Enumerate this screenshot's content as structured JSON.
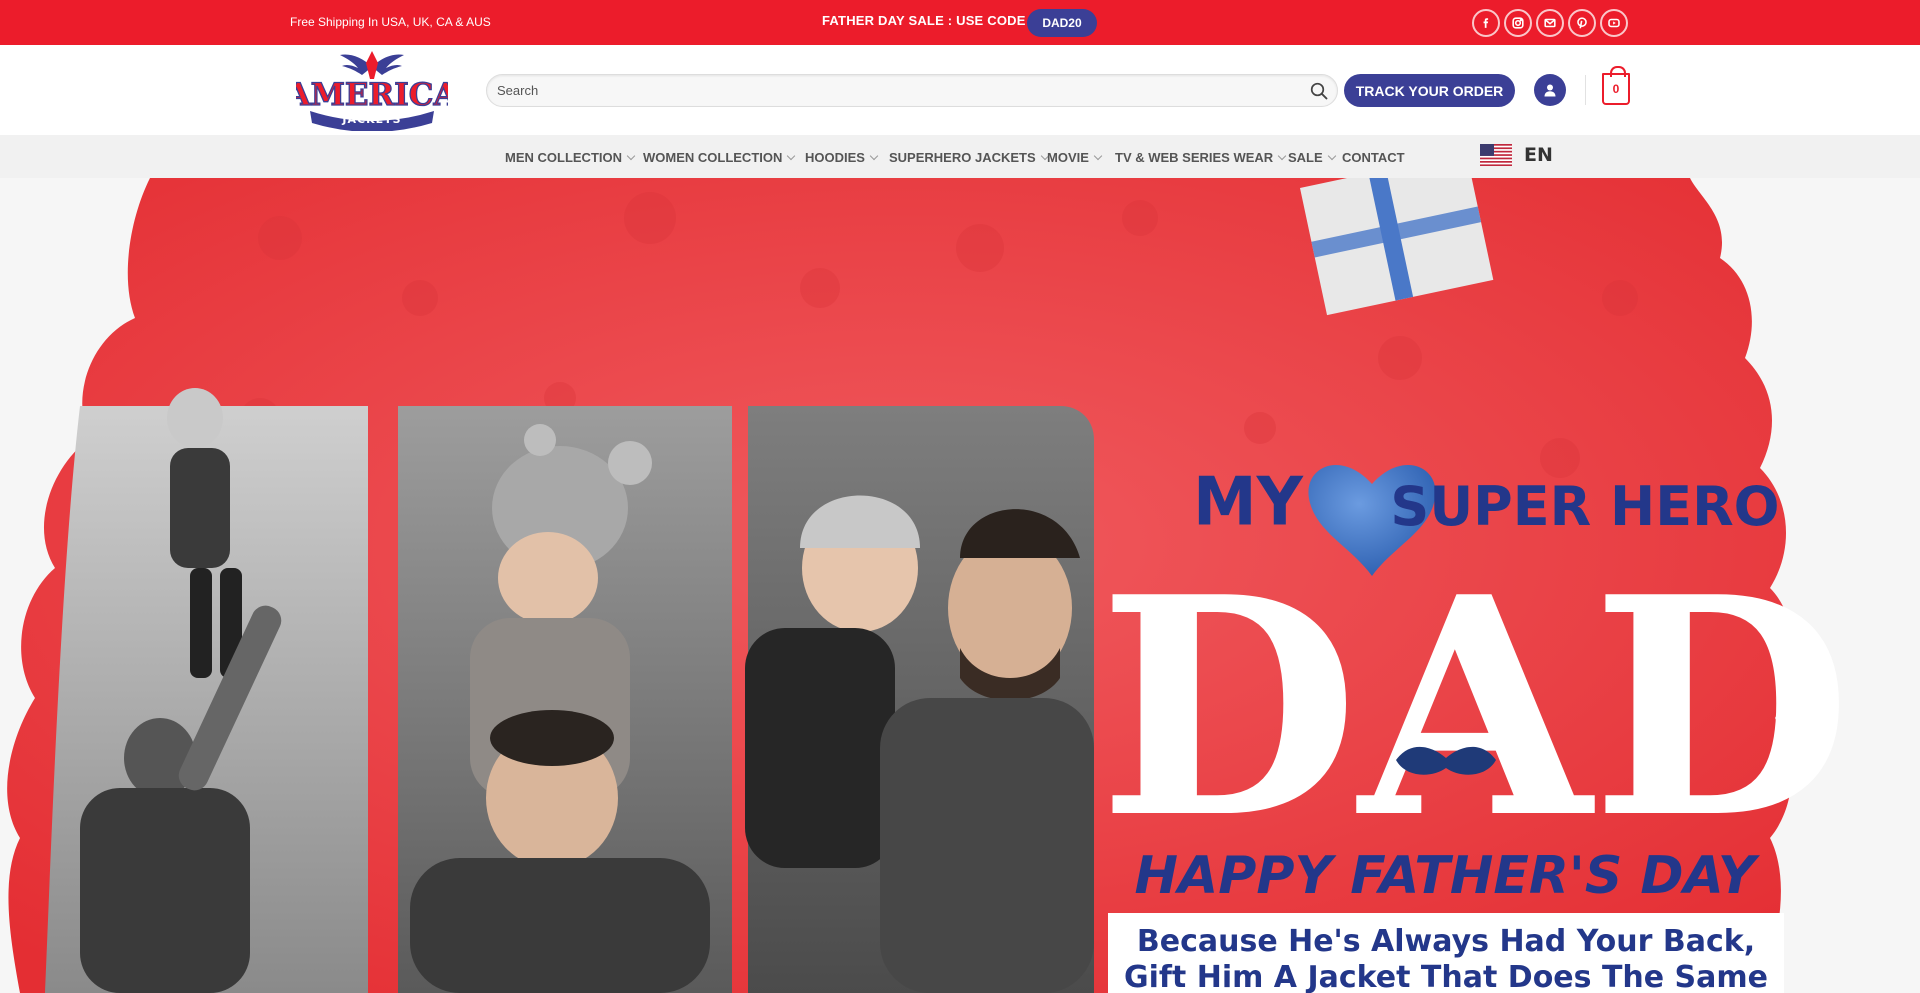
{
  "colors": {
    "brand_red": "#ec1c2b",
    "brand_navy": "#3b3f96",
    "nav_bg": "#f1f1f1"
  },
  "topbar": {
    "shipping_text": "Free Shipping In USA, UK, CA & AUS",
    "sale_text": "FATHER DAY SALE : USE CODE",
    "coupon_code": "DAD20",
    "social_icons": [
      "facebook-icon",
      "instagram-icon",
      "email-icon",
      "pinterest-icon",
      "youtube-icon"
    ]
  },
  "header": {
    "logo_text_top": "AMERICA",
    "logo_text_bottom": "JACKETS",
    "search_placeholder": "Search",
    "track_order_label": "TRACK YOUR ORDER",
    "cart_count": "0"
  },
  "nav": {
    "items": [
      {
        "label": "MEN COLLECTION",
        "has_dropdown": true
      },
      {
        "label": "WOMEN COLLECTION",
        "has_dropdown": true
      },
      {
        "label": "HOODIES",
        "has_dropdown": true
      },
      {
        "label": "SUPERHERO JACKETS",
        "has_dropdown": true
      },
      {
        "label": "MOVIE",
        "has_dropdown": true
      },
      {
        "label": "TV & WEB SERIES WEAR",
        "has_dropdown": true
      },
      {
        "label": "SALE",
        "has_dropdown": true
      },
      {
        "label": "CONTACT",
        "has_dropdown": false
      }
    ],
    "language": "EN"
  },
  "hero": {
    "line_my": "MY",
    "line_super_hero": "SUPER HERO",
    "line_dad": "DAD",
    "line_happy": "HAPPY FATHER'S DAY",
    "tagline_1": "Because He's Always Had Your Back,",
    "tagline_2": "Gift Him A Jacket That Does The Same"
  }
}
